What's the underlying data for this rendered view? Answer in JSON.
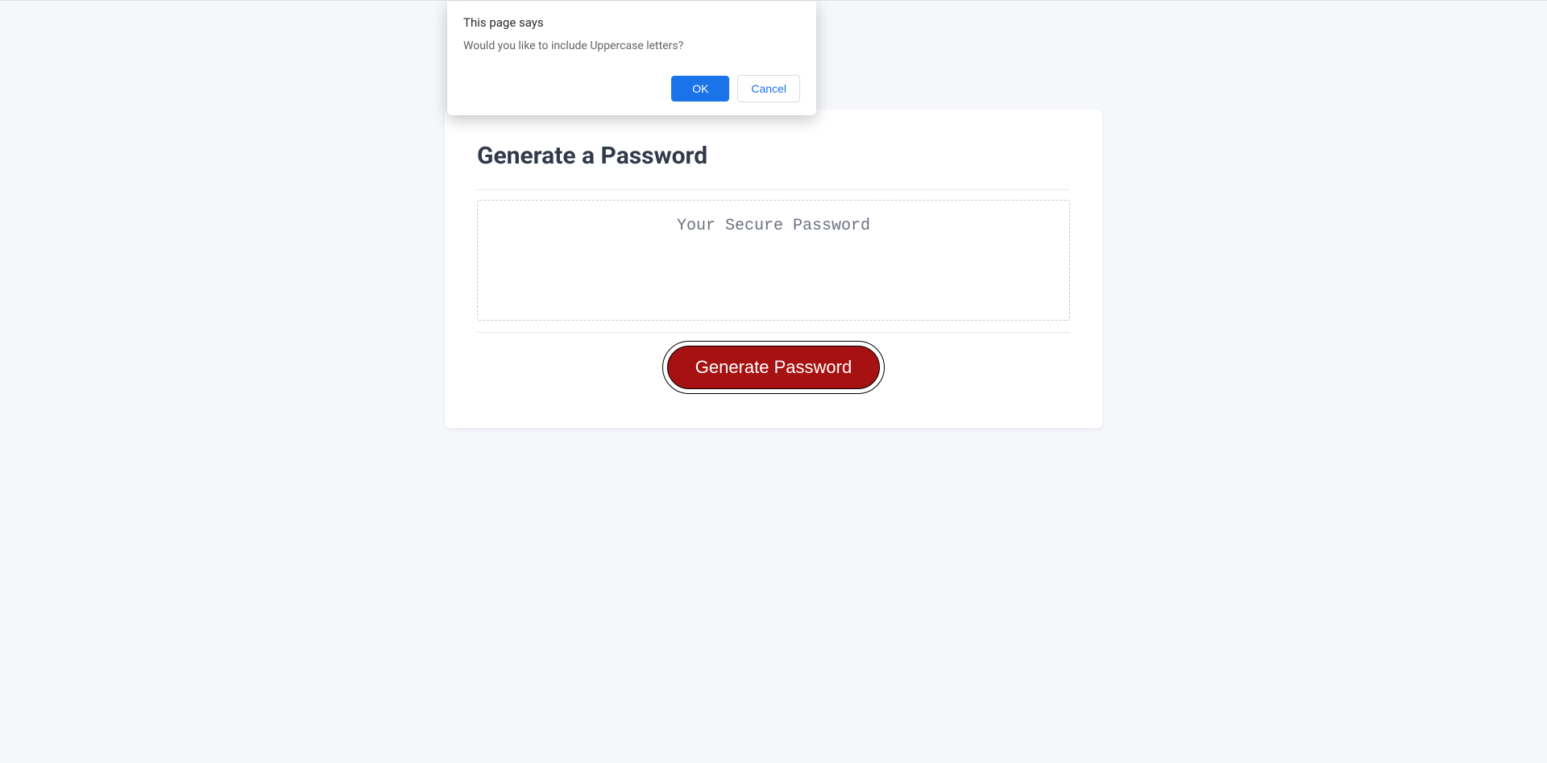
{
  "card": {
    "title": "Generate a Password",
    "placeholder_text": "Your Secure Password",
    "generate_button_label": "Generate Password"
  },
  "dialog": {
    "title": "This page says",
    "message": "Would you like to include Uppercase letters?",
    "ok_label": "OK",
    "cancel_label": "Cancel"
  }
}
